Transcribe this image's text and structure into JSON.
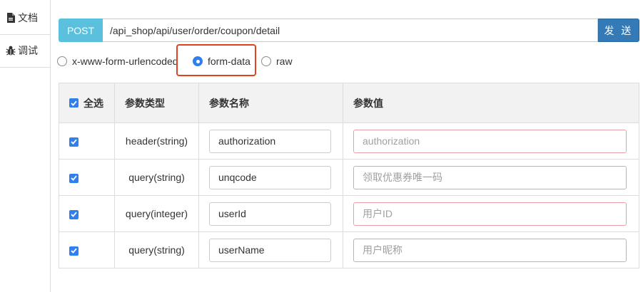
{
  "sidebar": {
    "items": [
      {
        "label": "文档",
        "icon": "document-icon"
      },
      {
        "label": "调试",
        "icon": "bug-icon"
      }
    ]
  },
  "request": {
    "method": "POST",
    "url": "/api_shop/api/user/order/coupon/detail",
    "send_label": "发 送"
  },
  "body_types": {
    "options": [
      "x-www-form-urlencoded",
      "form-data",
      "raw"
    ],
    "selected": "form-data"
  },
  "params": {
    "headers": {
      "select_all": "全选",
      "type": "参数类型",
      "name": "参数名称",
      "value": "参数值"
    },
    "select_all_checked": true,
    "rows": [
      {
        "checked": true,
        "type": "header(string)",
        "name": "authorization",
        "value_placeholder": "authorization"
      },
      {
        "checked": true,
        "type": "query(string)",
        "name": "unqcode",
        "value_placeholder": "领取优惠券唯一码"
      },
      {
        "checked": true,
        "type": "query(integer)",
        "name": "userId",
        "value_placeholder": "用户ID"
      },
      {
        "checked": true,
        "type": "query(string)",
        "name": "userName",
        "value_placeholder": "用户昵称"
      }
    ]
  },
  "colors": {
    "method_badge": "#5bc0de",
    "send_button": "#337ab7",
    "checkbox": "#2f7ff0",
    "highlight_box": "#e0421f",
    "value_input_border": "#e8a0a7"
  }
}
